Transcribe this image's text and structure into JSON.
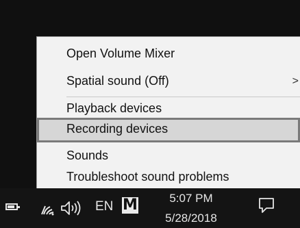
{
  "context_menu": {
    "items": [
      {
        "label": "Open Volume Mixer"
      },
      {
        "label": "Spatial sound (Off)",
        "submenu_arrow": ">"
      },
      {
        "label": "Playback devices"
      },
      {
        "label": "Recording devices",
        "highlighted": true
      },
      {
        "label": "Sounds"
      },
      {
        "label": "Troubleshoot sound problems"
      }
    ]
  },
  "taskbar": {
    "language": "EN",
    "ime_label": "M",
    "clock": {
      "time": "5:07 PM",
      "date": "5/28/2018"
    },
    "icons": [
      "battery-icon",
      "wifi-icon",
      "volume-icon",
      "action-center-icon"
    ]
  },
  "colors": {
    "menu_background": "#f2f2f2",
    "highlight_background": "#d6d6d6",
    "highlight_border": "#7a7a7a",
    "taskbar_background": "#141414",
    "desktop_background": "#101010"
  }
}
